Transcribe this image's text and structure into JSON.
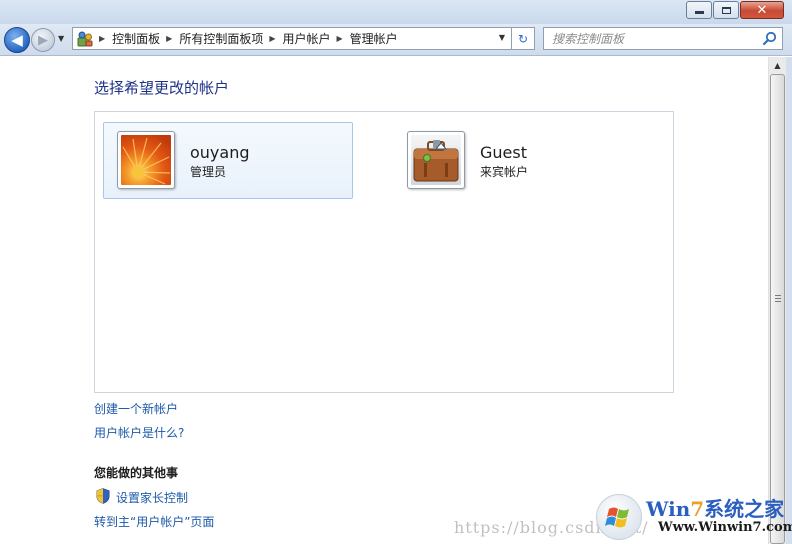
{
  "window": {
    "minimize_glyph": "",
    "maximize_glyph": "",
    "close_glyph": "✕"
  },
  "nav": {
    "back_glyph": "◀",
    "forward_glyph": "▶",
    "breadcrumbs": [
      "控制面板",
      "所有控制面板项",
      "用户帐户",
      "管理帐户"
    ],
    "refresh_glyph": "↻",
    "search_placeholder": "搜索控制面板"
  },
  "page": {
    "title": "选择希望更改的帐户",
    "accounts": [
      {
        "name": "ouyang",
        "role": "管理员",
        "selected": true,
        "avatar": "flower"
      },
      {
        "name": "Guest",
        "role": "来宾帐户",
        "selected": false,
        "avatar": "suitcase"
      }
    ],
    "links": {
      "create_account": "创建一个新帐户",
      "what_is_account": "用户帐户是什么?"
    },
    "other_tasks": {
      "title": "您能做的其他事",
      "parental_controls": "设置家长控制",
      "go_to_user_accounts": "转到主“用户帐户”页面"
    }
  },
  "watermark": {
    "url": "https://blog.csdn.net/",
    "brand_part1": "Win",
    "brand_part2": "7",
    "brand_part3": "系统之家",
    "site": "Www.Winwin7.com"
  },
  "colors": {
    "link": "#1c5aa8",
    "title": "#1e3287",
    "selection_border": "#a6c8e6"
  },
  "icons": {
    "address": "control-panel-icon",
    "search": "search-icon",
    "shield": "shield-icon"
  }
}
